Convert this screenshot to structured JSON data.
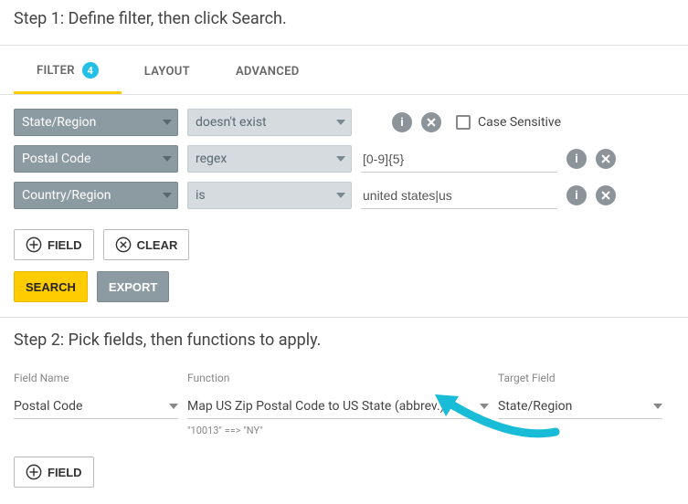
{
  "step1": {
    "title": "Step 1: Define filter, then click Search.",
    "tabs": {
      "filter": "FILTER",
      "filter_badge": "4",
      "layout": "LAYOUT",
      "advanced": "ADVANCED"
    },
    "rows": [
      {
        "field": "State/Region",
        "op": "doesn't exist",
        "value": "",
        "has_value": false
      },
      {
        "field": "Postal Code",
        "op": "regex",
        "value": "[0-9]{5}",
        "has_value": true
      },
      {
        "field": "Country/Region",
        "op": "is",
        "value": "united states|us",
        "has_value": true
      }
    ],
    "case_sensitive_label": "Case Sensitive",
    "buttons": {
      "add_field": "FIELD",
      "clear": "CLEAR",
      "search": "SEARCH",
      "export": "EXPORT"
    }
  },
  "step2": {
    "title": "Step 2: Pick fields, then functions to apply.",
    "headers": {
      "field_name": "Field Name",
      "function": "Function",
      "target_field": "Target Field"
    },
    "row": {
      "field_name": "Postal Code",
      "function": "Map US Zip Postal Code to US State (abbrev.)",
      "hint": "\"10013\" ==> \"NY\"",
      "target_field": "State/Region"
    },
    "add_field": "FIELD"
  }
}
